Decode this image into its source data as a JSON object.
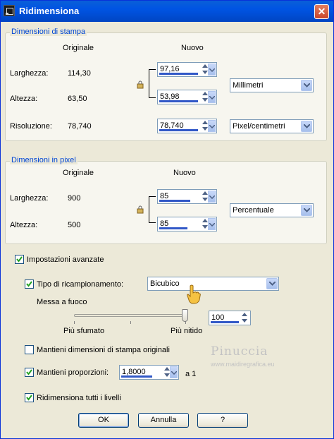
{
  "window": {
    "title": "Ridimensiona",
    "close_label": "✕"
  },
  "print_group": {
    "label": "Dimensioni di stampa",
    "col_original": "Originale",
    "col_new": "Nuovo",
    "width_label": "Larghezza:",
    "width_original": "114,30",
    "width_new": "97,16",
    "height_label": "Altezza:",
    "height_original": "63,50",
    "height_new": "53,98",
    "resolution_label": "Risoluzione:",
    "resolution_original": "78,740",
    "resolution_new": "78,740",
    "units": "Millimetri",
    "res_units": "Pixel/centimetri"
  },
  "pixel_group": {
    "label": "Dimensioni in pixel",
    "col_original": "Originale",
    "col_new": "Nuovo",
    "width_label": "Larghezza:",
    "width_original": "900",
    "width_new": "85",
    "height_label": "Altezza:",
    "height_original": "500",
    "height_new": "85",
    "units": "Percentuale"
  },
  "advanced": {
    "label": "Impostazioni avanzate",
    "checked": true,
    "resample_label": "Tipo di ricampionamento:",
    "resample_checked": true,
    "resample_value": "Bicubico",
    "sharpen_label": "Messa a fuoco",
    "slider_min_label": "Più sfumato",
    "slider_max_label": "Più nitido",
    "sharpen_value": "100",
    "keep_print_label": "Mantieni dimensioni di stampa originali",
    "keep_print_checked": false,
    "keep_ratio_label": "Mantieni proporzioni:",
    "keep_ratio_checked": true,
    "ratio_value": "1,8000",
    "ratio_suffix": "a 1",
    "resize_all_label": "Ridimensiona tutti i livelli",
    "resize_all_checked": true
  },
  "buttons": {
    "ok": "OK",
    "cancel": "Annulla",
    "help": "?"
  },
  "watermark": {
    "name": "Pinuccia",
    "url": "www.maidiregrafica.eu"
  }
}
